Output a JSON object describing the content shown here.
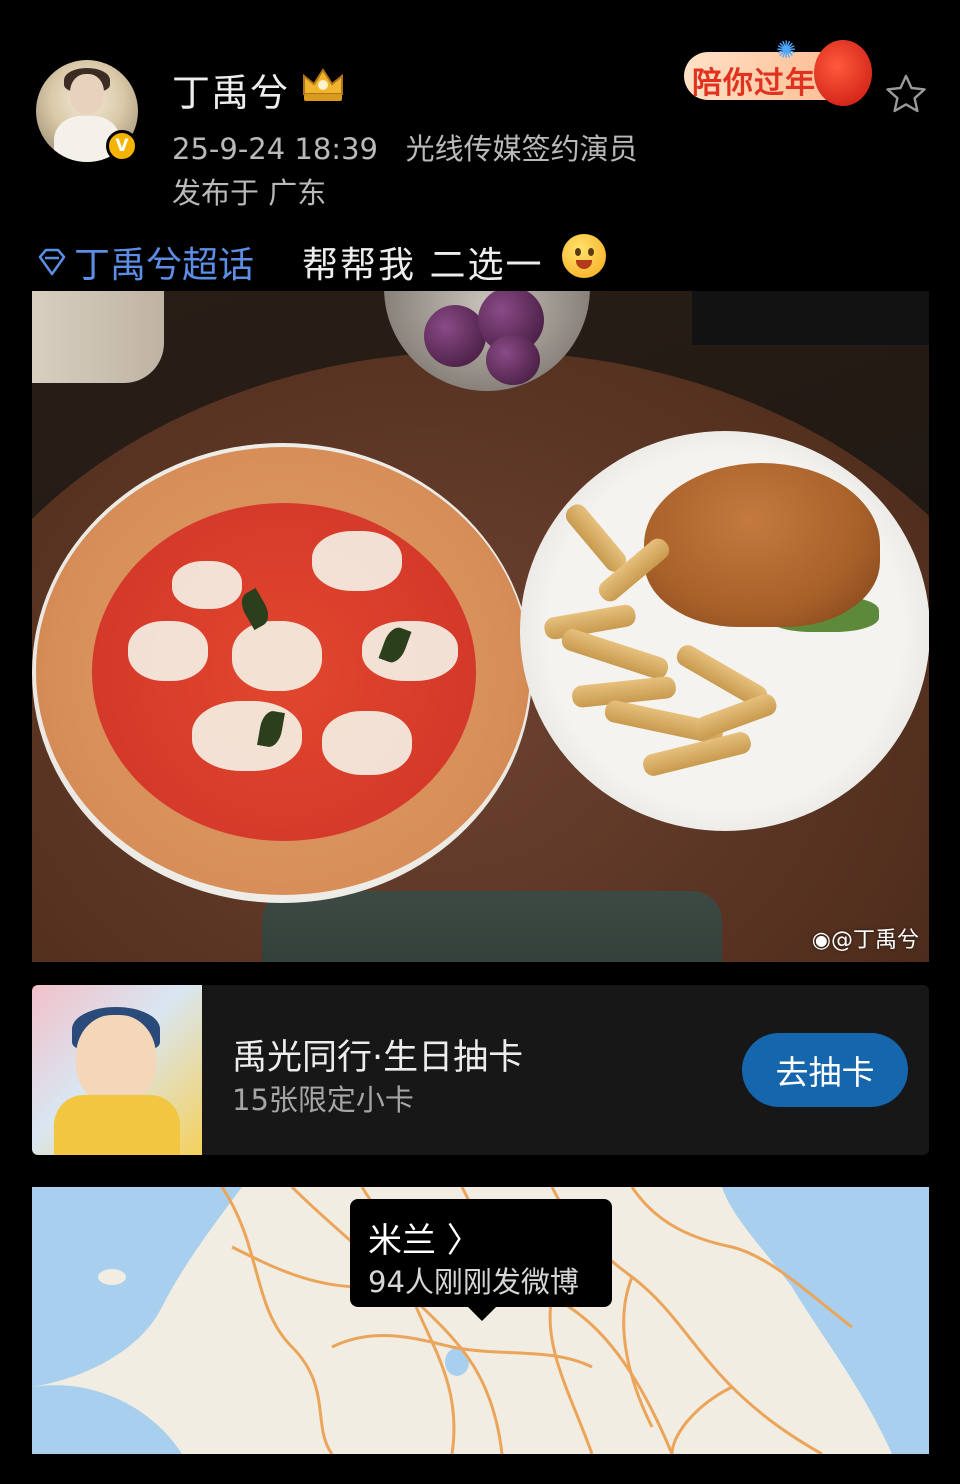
{
  "header": {
    "username": "丁禹兮",
    "timestamp": "25-9-24 18:39",
    "source": "光线传媒签约演员",
    "location_label": "发布于 广东",
    "verified_mark": "V",
    "badge_text": "陪你过年"
  },
  "post": {
    "supertopic": "丁禹兮超话",
    "text": "帮帮我  二选一",
    "watermark": "@丁禹兮"
  },
  "card": {
    "title": "禹光同行·生日抽卡",
    "subtitle": "15张限定小卡",
    "button": "去抽卡"
  },
  "map": {
    "place": "米兰 〉",
    "activity": "94人刚刚发微博"
  },
  "colors": {
    "background": "#000000",
    "link_blue": "#5d8ee6",
    "button_blue": "#1566ac",
    "card_bg": "#171717",
    "map_road": "#eba55a",
    "sea": "#a9cfee"
  },
  "icons": [
    "crown-level-icon",
    "verified-icon",
    "star-icon",
    "supertopic-diamond-icon",
    "grin-emoji-icon",
    "weibo-logo-icon",
    "lantern-icon"
  ]
}
